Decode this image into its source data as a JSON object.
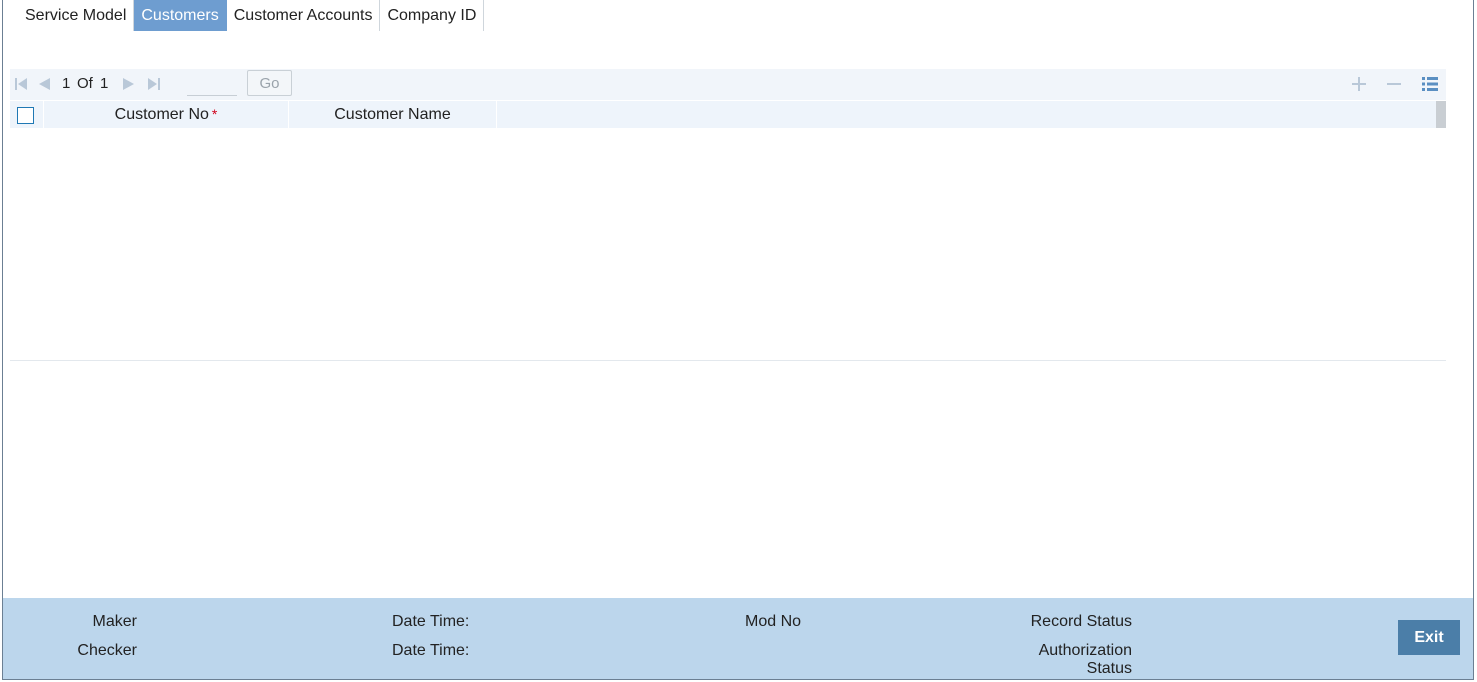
{
  "tabs": [
    {
      "label": "Service Model",
      "active": false
    },
    {
      "label": "Customers",
      "active": true
    },
    {
      "label": "Customer Accounts",
      "active": false
    },
    {
      "label": "Company ID",
      "active": false
    }
  ],
  "pagination": {
    "current": "1",
    "of_label": "Of",
    "total": "1",
    "page_input_value": "",
    "go_label": "Go"
  },
  "grid": {
    "columns": [
      {
        "label": "Customer No",
        "required": true,
        "required_mark": "*"
      },
      {
        "label": "Customer Name",
        "required": false
      }
    ],
    "rows": []
  },
  "footer": {
    "maker_label": "Maker",
    "checker_label": "Checker",
    "datetime_label_1": "Date Time:",
    "datetime_label_2": "Date Time:",
    "modno_label": "Mod No",
    "record_status_label": "Record Status",
    "auth_status_line1": "Authorization",
    "auth_status_line2": "Status",
    "exit_label": "Exit"
  },
  "colors": {
    "active_tab": "#6e9dd0",
    "footer_bg": "#bcd6ec",
    "exit_button": "#4b7ea8",
    "required_mark": "#d0021b",
    "toolbar_bg": "#f1f5fa"
  }
}
